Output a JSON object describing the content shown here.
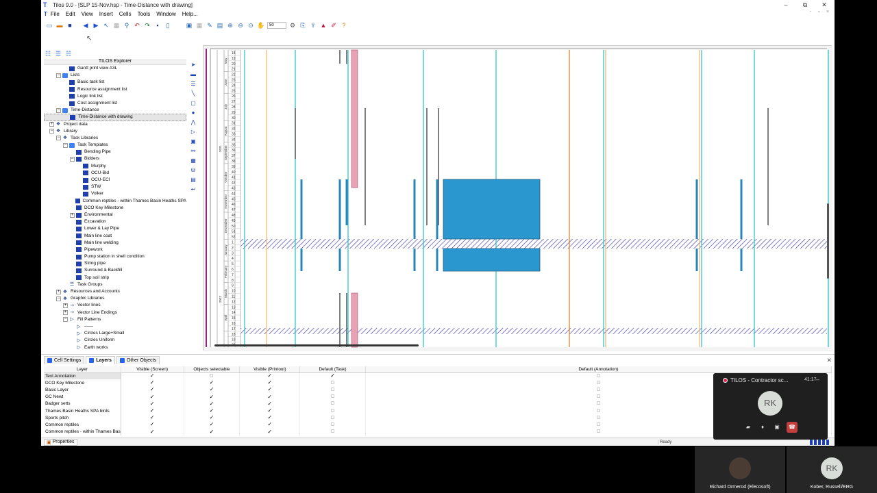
{
  "window": {
    "title": "Tilos 9.0 - [SLP 15-Nov.hsp - Time-Distance with drawing]",
    "logo": "T"
  },
  "window_controls": {
    "minimize": "–",
    "restore": "⧉",
    "close": "✕",
    "mdi_min": "-",
    "mdi_restore": "▫",
    "mdi_close": "×"
  },
  "menu": [
    "File",
    "Edit",
    "View",
    "Insert",
    "Cells",
    "Tools",
    "Window",
    "Help..."
  ],
  "toolbar": {
    "zoom_value": "50"
  },
  "explorer": {
    "header": "TILOS Explorer",
    "items": [
      {
        "label": "Gantt print view A3L",
        "level": 3,
        "icon": "gantt-icon"
      },
      {
        "label": "Lists",
        "level": 2,
        "icon": "folder-icon",
        "exp": "-"
      },
      {
        "label": "Basic task list",
        "level": 3,
        "icon": "list-icon"
      },
      {
        "label": "Resource assignment list",
        "level": 3,
        "icon": "resource-icon"
      },
      {
        "label": "Logic link list",
        "level": 3,
        "icon": "link-icon"
      },
      {
        "label": "Cost assignment list",
        "level": 3,
        "icon": "cost-icon"
      },
      {
        "label": "Time-Distance",
        "level": 2,
        "icon": "folder-icon",
        "exp": "-"
      },
      {
        "label": "Time-Distance with drawing",
        "level": 3,
        "icon": "view-icon",
        "selected": true
      },
      {
        "label": "Project data",
        "level": 1,
        "icon": "cube-icon",
        "exp": "+"
      },
      {
        "label": "Library",
        "level": 1,
        "icon": "cube-icon",
        "exp": "-"
      },
      {
        "label": "Task Libraries",
        "level": 2,
        "icon": "cube-icon",
        "exp": "-"
      },
      {
        "label": "Task Templates",
        "level": 3,
        "icon": "folder-icon",
        "exp": "-"
      },
      {
        "label": "Bending Pipe",
        "level": 4,
        "icon": "template-icon"
      },
      {
        "label": "Bidders",
        "level": 4,
        "icon": "template-icon",
        "exp": "-"
      },
      {
        "label": "Murphy",
        "level": 5,
        "icon": "template-icon"
      },
      {
        "label": "OCU-Bid",
        "level": 5,
        "icon": "template-icon"
      },
      {
        "label": "OCU-ECI",
        "level": 5,
        "icon": "template-icon"
      },
      {
        "label": "STW",
        "level": 5,
        "icon": "template-icon"
      },
      {
        "label": "Volker",
        "level": 5,
        "icon": "template-icon"
      },
      {
        "label": "Common reptiles - within Thames Basin Heaths SPA",
        "level": 4,
        "icon": "template-icon"
      },
      {
        "label": "DCO Key Milestone",
        "level": 4,
        "icon": "template-icon"
      },
      {
        "label": "Environmental",
        "level": 4,
        "icon": "template-icon",
        "exp": "+"
      },
      {
        "label": "Excavation",
        "level": 4,
        "icon": "template-icon"
      },
      {
        "label": "Lower & Lay Pipe",
        "level": 4,
        "icon": "template-icon"
      },
      {
        "label": "Main line coat",
        "level": 4,
        "icon": "template-icon"
      },
      {
        "label": "Main line welding",
        "level": 4,
        "icon": "template-icon"
      },
      {
        "label": "Pipework",
        "level": 4,
        "icon": "template-icon"
      },
      {
        "label": "Pump station in shell condition",
        "level": 4,
        "icon": "template-icon"
      },
      {
        "label": "String pipe",
        "level": 4,
        "icon": "template-icon"
      },
      {
        "label": "Surround & Backfill",
        "level": 4,
        "icon": "template-icon"
      },
      {
        "label": "Top soil strip",
        "level": 4,
        "icon": "template-icon"
      },
      {
        "label": "Task Groups",
        "level": 3,
        "icon": "lines-icon"
      },
      {
        "label": "Resources and Accounts",
        "level": 2,
        "icon": "cube-icon",
        "exp": "+"
      },
      {
        "label": "Graphic Libraries",
        "level": 2,
        "icon": "cube-icon",
        "exp": "-"
      },
      {
        "label": "Vector lines",
        "level": 3,
        "icon": "vector-icon",
        "exp": "+"
      },
      {
        "label": "Vector Line Endings",
        "level": 3,
        "icon": "vector-icon",
        "exp": "+"
      },
      {
        "label": "Fill Patterns",
        "level": 3,
        "icon": "pattern-icon",
        "exp": "-"
      },
      {
        "label": "——",
        "level": 4,
        "icon": "pattern-icon"
      },
      {
        "label": "Circles Large+Small",
        "level": 4,
        "icon": "pattern-icon"
      },
      {
        "label": "Circles Uniform",
        "level": 4,
        "icon": "pattern-icon"
      },
      {
        "label": "Earth works",
        "level": 4,
        "icon": "pattern-icon"
      }
    ]
  },
  "chart_labels": {
    "months": [
      "May",
      "June",
      "July",
      "August",
      "September",
      "October",
      "November",
      "December",
      "January",
      "February",
      "March",
      "April"
    ],
    "years": [
      "2021",
      "2022"
    ],
    "weeks": [
      "18",
      "19",
      "20",
      "21",
      "22",
      "23",
      "24",
      "25",
      "26",
      "27",
      "28",
      "29",
      "30",
      "31",
      "32",
      "33",
      "34",
      "35",
      "36",
      "37",
      "38",
      "39",
      "40",
      "41",
      "42",
      "43",
      "44",
      "45",
      "46",
      "47",
      "48",
      "49",
      "50",
      "51",
      "52",
      "1",
      "2",
      "3",
      "4",
      "5",
      "6",
      "7",
      "8",
      "9",
      "10",
      "11",
      "12",
      "13",
      "14",
      "15",
      "16",
      "17",
      "18",
      "19",
      "20"
    ]
  },
  "bottom_panel": {
    "tabs": [
      "Cell Settings",
      "Layers",
      "Other Objects"
    ],
    "active_tab": "Layers",
    "columns": [
      "Layer",
      "Visible (Screen)",
      "Objects  selectable",
      "Visible (Printout)",
      "Default (Task)",
      "Default (Annotation)"
    ],
    "rows": [
      {
        "name": "Text Annotation",
        "screen": true,
        "selectable": false,
        "printout": true,
        "task": true,
        "selected": true
      },
      {
        "name": "DCO Key Milestone",
        "screen": true,
        "selectable": true,
        "printout": true,
        "task": false
      },
      {
        "name": "Basic Layer",
        "screen": true,
        "selectable": true,
        "printout": true,
        "task": false
      },
      {
        "name": "GC Newt",
        "screen": true,
        "selectable": true,
        "printout": true,
        "task": false
      },
      {
        "name": "Badger setts",
        "screen": true,
        "selectable": true,
        "printout": true,
        "task": false
      },
      {
        "name": "Thames Basin Heaths SPA birds",
        "screen": true,
        "selectable": true,
        "printout": true,
        "task": false
      },
      {
        "name": "Sports pitch",
        "screen": true,
        "selectable": true,
        "printout": true,
        "task": false
      },
      {
        "name": "Common reptiles",
        "screen": true,
        "selectable": true,
        "printout": true,
        "task": false
      },
      {
        "name": "Common reptiles - within Thames Bas",
        "screen": true,
        "selectable": true,
        "printout": true,
        "task": false
      }
    ]
  },
  "statusbar": {
    "properties": "Properties",
    "ready": "Ready"
  },
  "call_window": {
    "title": "TILOS - Contractor sc...",
    "timer": "41:17",
    "avatar": "RK"
  },
  "participants": [
    {
      "initials": "",
      "name": "Richard Ormerod (Elecosoft)"
    },
    {
      "initials": "RK",
      "name": "Kober, Russell/ERG"
    }
  ]
}
